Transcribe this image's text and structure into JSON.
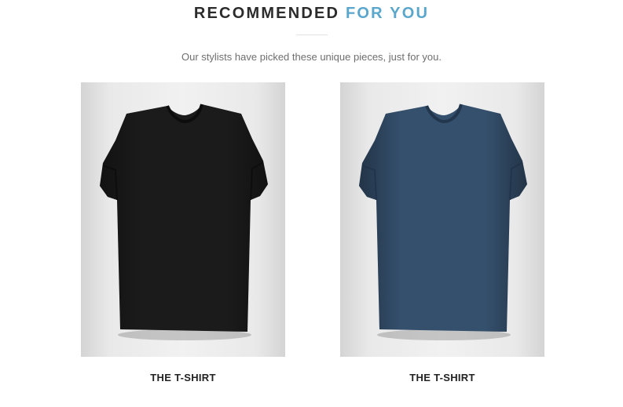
{
  "section": {
    "title_part1": "RECOMMENDED",
    "title_part2": "FOR YOU",
    "subtitle": "Our stylists have picked these unique pieces, just for you."
  },
  "products": [
    {
      "name": "THE T-SHIRT",
      "color": "#1b1b1b",
      "image_icon": "black-tshirt-photo"
    },
    {
      "name": "THE T-SHIRT",
      "color": "#35506d",
      "image_icon": "navy-tshirt-photo"
    }
  ],
  "colors": {
    "heading": "#2b2b2b",
    "accent": "#5aa6cc",
    "subtitle": "#6e6e6e"
  }
}
